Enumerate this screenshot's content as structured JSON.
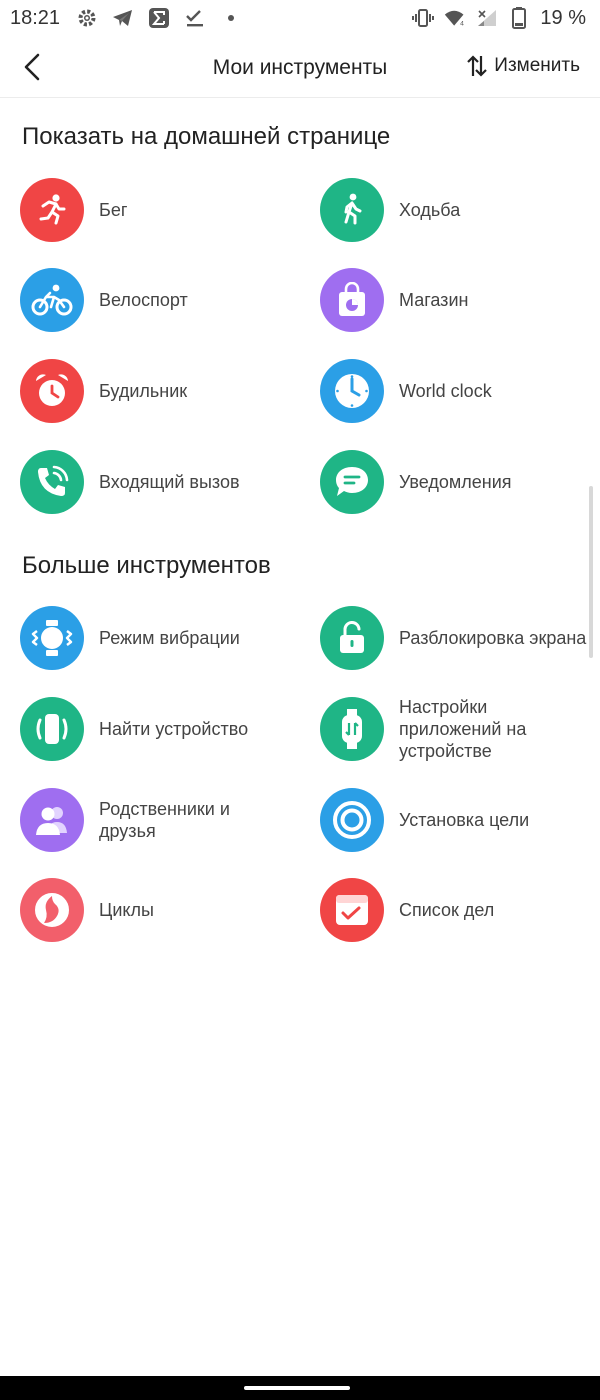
{
  "status_bar": {
    "time": "18:21",
    "battery": "19 %"
  },
  "header": {
    "title": "Мои инструменты",
    "edit_label": "Изменить"
  },
  "sections": {
    "home": {
      "title": "Показать на домашней странице",
      "items": [
        {
          "label": "Бег",
          "icon": "run-icon",
          "color": "#f04545"
        },
        {
          "label": "Ходьба",
          "icon": "walk-icon",
          "color": "#1fb586"
        },
        {
          "label": "Велоспорт",
          "icon": "bike-icon",
          "color": "#2b9fe6"
        },
        {
          "label": "Магазин",
          "icon": "shop-bag-icon",
          "color": "#9f6ef0"
        },
        {
          "label": "Будильник",
          "icon": "alarm-icon",
          "color": "#f04545"
        },
        {
          "label": "World clock",
          "icon": "world-clock-icon",
          "color": "#2b9fe6"
        },
        {
          "label": "Входящий вызов",
          "icon": "incoming-call-icon",
          "color": "#1fb586"
        },
        {
          "label": "Уведомления",
          "icon": "notification-icon",
          "color": "#1fb586"
        }
      ]
    },
    "more": {
      "title": "Больше инструментов",
      "items": [
        {
          "label": "Режим вибрации",
          "icon": "vibration-icon",
          "color": "#2b9fe6"
        },
        {
          "label": "Разблокировка экрана",
          "icon": "unlock-icon",
          "color": "#1fb586"
        },
        {
          "label": "Найти устройство",
          "icon": "find-device-icon",
          "color": "#1fb586"
        },
        {
          "label": "Настройки приложений на устройстве",
          "icon": "band-settings-icon",
          "color": "#1fb586"
        },
        {
          "label": "Родственники и друзья",
          "icon": "friends-icon",
          "color": "#9f6ef0"
        },
        {
          "label": "Установка цели",
          "icon": "goal-target-icon",
          "color": "#2b9fe6"
        },
        {
          "label": "Циклы",
          "icon": "cycle-icon",
          "color": "#f25f6b"
        },
        {
          "label": "Список дел",
          "icon": "todo-list-icon",
          "color": "#f04545"
        }
      ]
    }
  }
}
